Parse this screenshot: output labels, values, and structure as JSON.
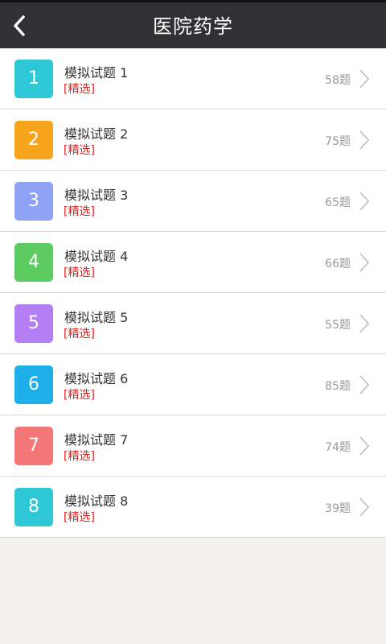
{
  "header": {
    "title": "医院药学",
    "back_icon": "back-arrow-icon"
  },
  "colors": {
    "header_bg": "#2f3133",
    "tag": "#e02020"
  },
  "exams": [
    {
      "number": "1",
      "title": "模拟试题 1",
      "tag": "[精选]",
      "count": "58题",
      "color": "#2ec7d6"
    },
    {
      "number": "2",
      "title": "模拟试题 2",
      "tag": "[精选]",
      "count": "75题",
      "color": "#f7a51c"
    },
    {
      "number": "3",
      "title": "模拟试题 3",
      "tag": "[精选]",
      "count": "65题",
      "color": "#8fa3f5"
    },
    {
      "number": "4",
      "title": "模拟试题 4",
      "tag": "[精选]",
      "count": "66题",
      "color": "#5ccb61"
    },
    {
      "number": "5",
      "title": "模拟试题 5",
      "tag": "[精选]",
      "count": "55题",
      "color": "#b47ef5"
    },
    {
      "number": "6",
      "title": "模拟试题 6",
      "tag": "[精选]",
      "count": "85题",
      "color": "#1eaee8"
    },
    {
      "number": "7",
      "title": "模拟试题 7",
      "tag": "[精选]",
      "count": "74题",
      "color": "#f47777"
    },
    {
      "number": "8",
      "title": "模拟试题 8",
      "tag": "[精选]",
      "count": "39题",
      "color": "#2ec7d6"
    }
  ]
}
